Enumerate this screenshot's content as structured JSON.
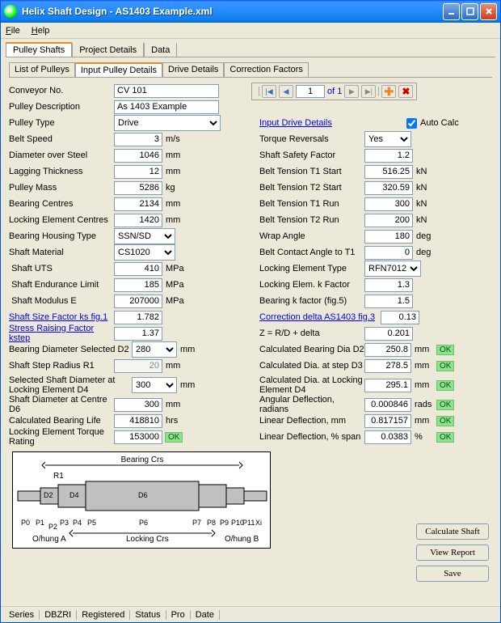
{
  "title": "Helix Shaft Design - AS1403 Example.xml",
  "menu": {
    "file": "File",
    "help": "Help"
  },
  "outerTabs": {
    "pulleyShafts": "Pulley Shafts",
    "projectDetails": "Project Details",
    "data": "Data"
  },
  "innerTabs": {
    "listOfPulleys": "List of Pulleys",
    "inputPulleyDetails": "Input Pulley Details",
    "driveDetails": "Drive Details",
    "correctionFactors": "Correction Factors"
  },
  "labels": {
    "conveyorNo": "Conveyor No.",
    "pulleyDescription": "Pulley Description",
    "pulleyType": "Pulley Type",
    "beltSpeed": "Belt Speed",
    "diameterOverSteel": "Diameter over Steel",
    "laggingThickness": "Lagging Thickness",
    "pulleyMass": "Pulley Mass",
    "bearingCentres": "Bearing Centres",
    "lockingElementCentres": "Locking Element Centres",
    "bearingHousingType": "Bearing Housing Type",
    "shaftMaterial": "Shaft Material",
    "shaftUTS": "Shaft UTS",
    "shaftEnduranceLimit": "Shaft Endurance Limit",
    "shaftModulusE": "Shaft Modulus E",
    "shaftSizeFactor": "Shaft Size Factor ks fig.1",
    "stressRaisingFactor": "Stress Raising Factor kstep",
    "bearingDiameterD2": "Bearing Diameter Selected D2",
    "shaftStepRadiusR1": "Shaft Step Radius R1",
    "selectedShaftDiamD4": "Selected Shaft Diameter at Locking Element D4",
    "shaftDiamCentreD6": "Shaft Diameter at Centre D6",
    "calcBearingLife": "Calculated Bearing Life",
    "lockElemTorqueRating": "Locking Element Torque Rating",
    "inputDriveDetails": "Input Drive Details",
    "autoCalc": "Auto Calc",
    "torqueReversals": "Torque Reversals",
    "shaftSafetyFactor": "Shaft Safety Factor",
    "beltTensionT1Start": "Belt Tension T1 Start",
    "beltTensionT2Start": "Belt Tension T2 Start",
    "beltTensionT1Run": "Belt Tension T1 Run",
    "beltTensionT2Run": "Belt Tension T2 Run",
    "wrapAngle": "Wrap Angle",
    "beltContactAngleT1": "Belt Contact Angle to T1",
    "lockingElementType": "Locking Element Type",
    "lockingElemKFactor": "Locking Elem. k Factor",
    "bearingKFactor": "Bearing k factor (fig.5)",
    "correctionDelta": "Correction delta AS1403 fig.3",
    "zEquation": "Z = R/D + delta",
    "calcBearingDiaD2": "Calculated Bearing Dia D2",
    "calcDiaStepD3": "Calculated Dia. at step D3",
    "calcDiaLockD4": "Calculated Dia. at Locking Element D4",
    "angularDeflection": "Angular Deflection, radians",
    "linearDeflectionMm": "Linear Deflection, mm",
    "linearDeflectionPct": "Linear Deflection, % span"
  },
  "values": {
    "conveyorNo": "CV 101",
    "pulleyDescription": "As 1403 Example",
    "pulleyType": "Drive",
    "beltSpeed": "3",
    "diameterOverSteel": "1046",
    "laggingThickness": "12",
    "pulleyMass": "5286",
    "bearingCentres": "2134",
    "lockingElementCentres": "1420",
    "bearingHousingType": "SSN/SD",
    "shaftMaterial": "CS1020",
    "shaftUTS": "410",
    "shaftEnduranceLimit": "185",
    "shaftModulusE": "207000",
    "shaftSizeFactor": "1.782",
    "stressRaisingFactor": "1.37",
    "bearingDiameterD2": "280",
    "shaftStepRadiusR1": "20",
    "selectedShaftDiamD4": "300",
    "shaftDiamCentreD6": "300",
    "calcBearingLife": "418810",
    "lockElemTorqueRating": "153000",
    "torqueReversals": "Yes",
    "shaftSafetyFactor": "1.2",
    "beltTensionT1Start": "516.25",
    "beltTensionT2Start": "320.59",
    "beltTensionT1Run": "300",
    "beltTensionT2Run": "200",
    "wrapAngle": "180",
    "beltContactAngleT1": "0",
    "lockingElementType": "RFN7012",
    "lockingElemKFactor": "1.3",
    "bearingKFactor": "1.5",
    "correctionDelta": "0.13",
    "zValue": "0.201",
    "calcBearingDiaD2": "250.8",
    "calcDiaStepD3": "278.5",
    "calcDiaLockD4": "295.1",
    "angularDeflection": "0.000846",
    "linearDeflectionMm": "0.817157",
    "linearDeflectionPct": "0.0383"
  },
  "units": {
    "ms": "m/s",
    "mm": "mm",
    "kg": "kg",
    "mpa": "MPa",
    "hrs": "hrs",
    "kn": "kN",
    "deg": "deg",
    "rads": "rads",
    "pct": "%"
  },
  "ok": "OK",
  "nav": {
    "page": "1",
    "of": "of 1"
  },
  "btns": {
    "calc": "Calculate Shaft",
    "view": "View Report",
    "save": "Save"
  },
  "status": {
    "series": "Series",
    "dbzri": "DBZRI",
    "registered": "Registered",
    "statusLbl": "Status",
    "pro": "Pro",
    "date": "Date"
  },
  "diagram": {
    "bearingCrs": "Bearing Crs",
    "lockingCrs": "Locking Crs",
    "r1": "R1",
    "d2": "D2",
    "d4": "D4",
    "d6": "D6",
    "xi": "Xi",
    "p0": "P0",
    "p1": "P1",
    "p2": "P2",
    "p3": "P3",
    "p4": "P4",
    "p5": "P5",
    "p6": "P6",
    "p7": "P7",
    "p8": "P8",
    "p9": "P9",
    "p10": "P10",
    "p11": "P11",
    "ohungA": "O/hung A",
    "ohungB": "O/hung B"
  }
}
